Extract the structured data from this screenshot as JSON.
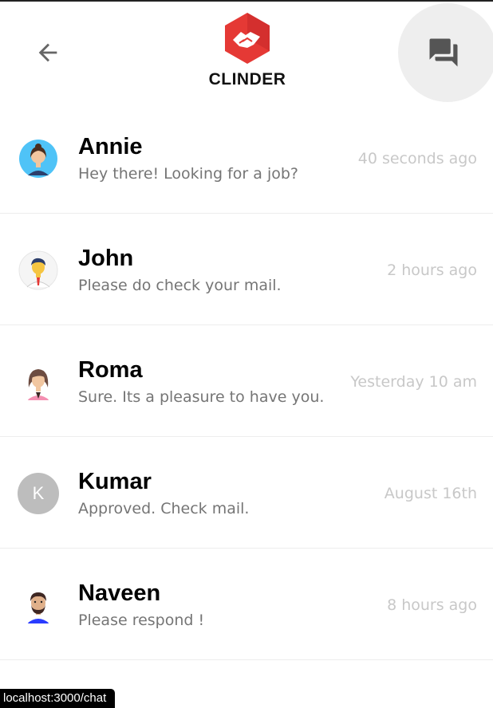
{
  "header": {
    "logo_text": "CLINDER",
    "back_icon": "arrow-left-icon",
    "chat_icon": "forum-icon"
  },
  "colors": {
    "brand_red": "#e53935",
    "name_text": "#000000",
    "message_text": "#757575",
    "time_text": "#c8c8c8",
    "chat_button_bg": "#eeeeee"
  },
  "chats": [
    {
      "name": "Annie",
      "message": "Hey there! Looking for a job?",
      "time": "40 seconds ago",
      "avatar": "woman-cyan-avatar"
    },
    {
      "name": "John",
      "message": "Please do check your mail.",
      "time": "2 hours ago",
      "avatar": "man-tie-avatar"
    },
    {
      "name": "Roma",
      "message": "Sure. Its a pleasure to have you.",
      "time": "Yesterday 10 am",
      "avatar": "woman-pink-avatar"
    },
    {
      "name": "Kumar",
      "message": "Approved. Check mail.",
      "time": "August 16th",
      "avatar_letter": "K"
    },
    {
      "name": "Naveen",
      "message": "Please respond !",
      "time": "8 hours ago",
      "avatar": "man-beard-avatar"
    }
  ],
  "status_bar": {
    "url": "localhost:3000/chat"
  }
}
